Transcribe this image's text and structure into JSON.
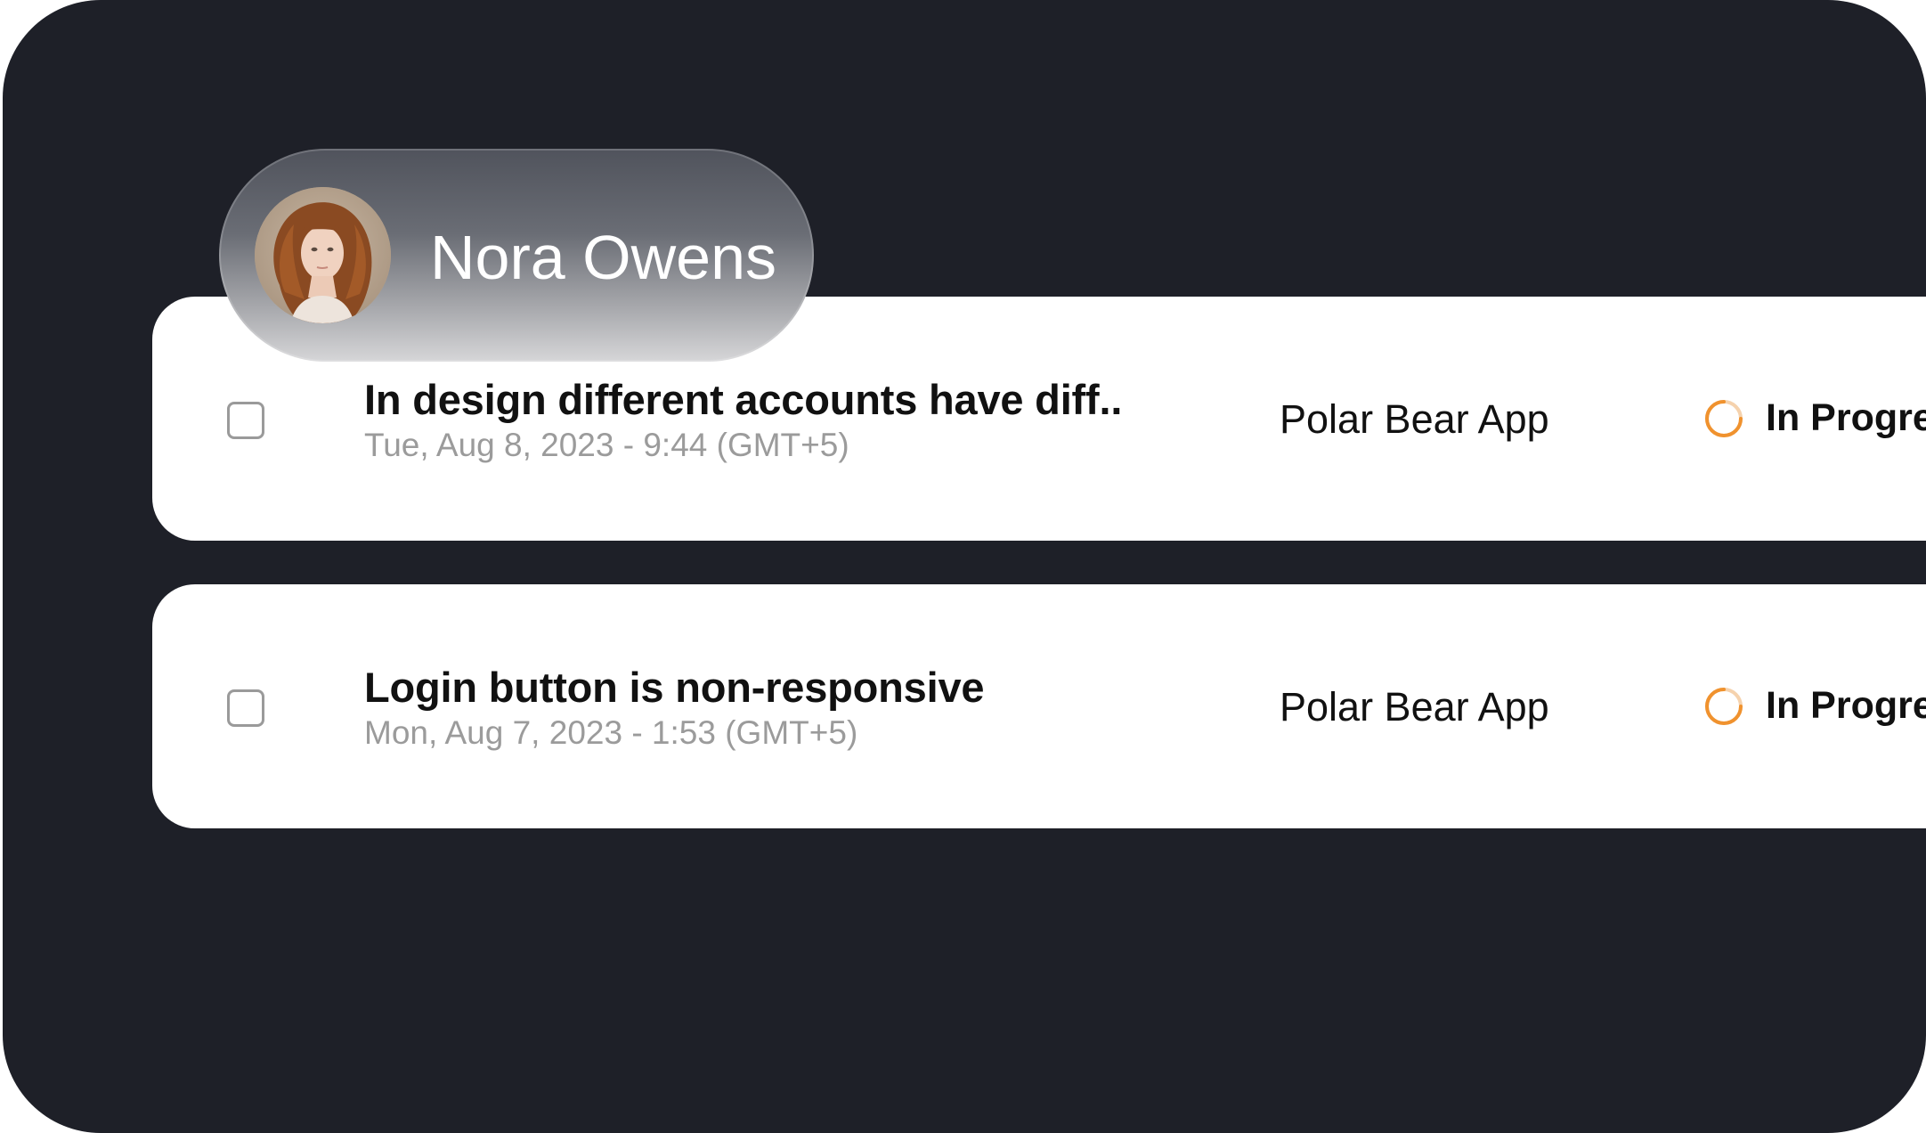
{
  "user": {
    "name": "Nora Owens"
  },
  "tasks": [
    {
      "title": "In design different accounts have diff..",
      "date": "Tue, Aug 8, 2023 - 9:44 (GMT+5)",
      "project": "Polar Bear App",
      "status": "In Progress",
      "checked": false
    },
    {
      "title": "Login button is non-responsive",
      "date": "Mon, Aug 7, 2023 - 1:53 (GMT+5)",
      "project": "Polar Bear App",
      "status": "In Progress",
      "checked": false
    }
  ],
  "colors": {
    "background": "#1e2028",
    "card": "#ffffff",
    "status_accent": "#f0922e",
    "date_text": "#9b9b9b"
  },
  "icons": {
    "status": "in-progress-spinner-icon",
    "checkbox": "checkbox-unchecked"
  }
}
